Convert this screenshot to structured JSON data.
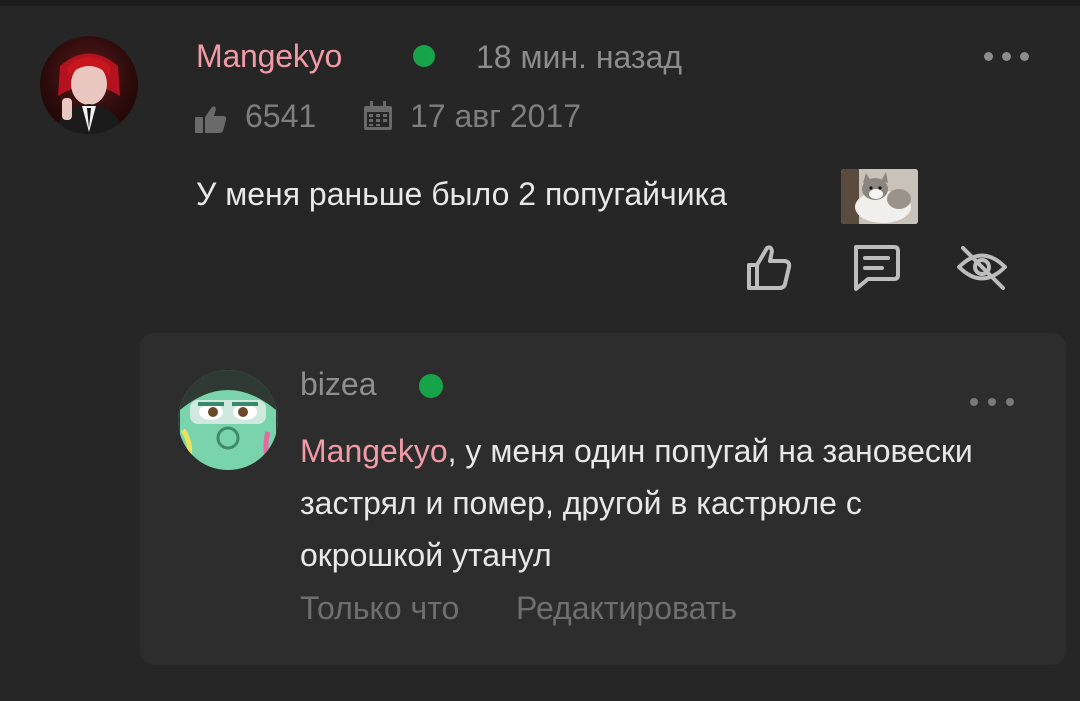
{
  "comment": {
    "author": "Mangekyo",
    "time": "18 мин. назад",
    "likes": "6541",
    "date": "17 авг 2017",
    "text": "У меня раньше было 2 попугайчика",
    "online": true
  },
  "reply": {
    "author": "bizea",
    "mention": "Mangekyo",
    "text": ", у меня один попугай на зановески застрял и помер, другой в кастрюле с окрошкой утанул",
    "time": "Только что",
    "edit_label": "Редактировать",
    "online": true
  },
  "colors": {
    "background": "#262626",
    "card": "#2d2d2d",
    "username": "#f29aa6",
    "online": "#17a34a",
    "muted": "#8c8c8c"
  },
  "icons": [
    "thumb-up-icon",
    "calendar-icon",
    "like-icon",
    "reply-icon",
    "hide-icon",
    "more-icon"
  ]
}
